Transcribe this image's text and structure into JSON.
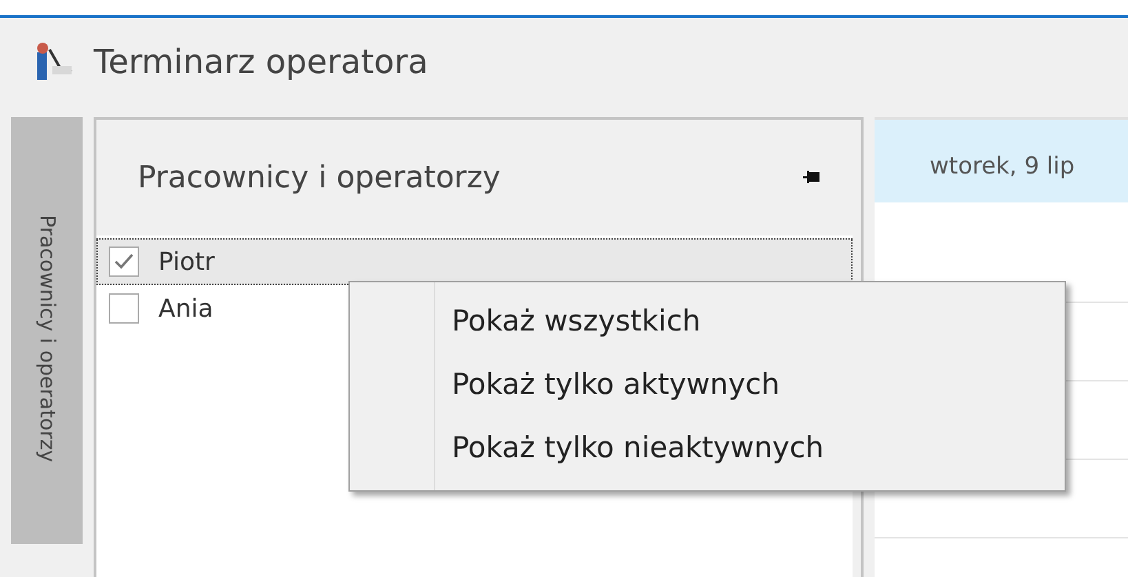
{
  "window": {
    "title": "Terminarz operatora"
  },
  "side_tab": {
    "label": "Pracownicy i operatorzy"
  },
  "panel": {
    "title": "Pracownicy i operatorzy",
    "items": [
      {
        "name": "Piotr",
        "checked": true,
        "selected": true
      },
      {
        "name": "Ania",
        "checked": false,
        "selected": false
      }
    ]
  },
  "calendar": {
    "day_header": "wtorek, 9 lip"
  },
  "context_menu": {
    "items": [
      "Pokaż wszystkich",
      "Pokaż tylko aktywnych",
      "Pokaż tylko nieaktywnych"
    ]
  }
}
